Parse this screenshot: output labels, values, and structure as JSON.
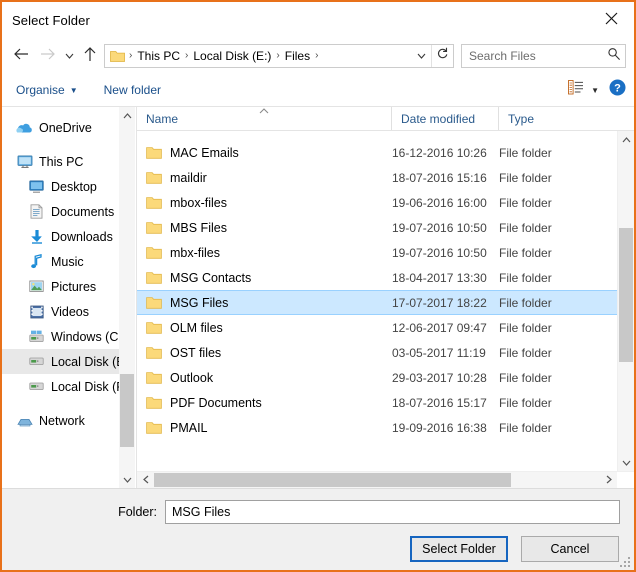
{
  "window": {
    "title": "Select Folder",
    "close_icon": "close-icon",
    "accent_border": "#e8711a"
  },
  "nav": {
    "back_icon": "arrow-left-icon",
    "forward_icon": "arrow-right-icon",
    "recent_icon": "chevron-down-icon",
    "up_icon": "arrow-up-icon",
    "address": {
      "folder_icon": "folder-icon",
      "crumbs": [
        "This PC",
        "Local Disk (E:)",
        "Files"
      ],
      "separator": "›",
      "dropdown_icon": "chevron-down-icon",
      "refresh_icon": "refresh-icon"
    },
    "search": {
      "placeholder": "Search Files",
      "value": "",
      "icon": "search-icon"
    }
  },
  "command_bar": {
    "organise_label": "Organise",
    "organise_caret": "▼",
    "new_folder_label": "New folder",
    "view_icon": "view-list-icon",
    "view_caret": "▼",
    "help_icon": "help-icon"
  },
  "sidebar": {
    "items": [
      {
        "label": "OneDrive",
        "icon": "onedrive-cloud-icon",
        "indent": false,
        "selected": false
      },
      {
        "label": "This PC",
        "icon": "this-pc-monitor-icon",
        "indent": false,
        "selected": false
      },
      {
        "label": "Desktop",
        "icon": "desktop-icon",
        "indent": true,
        "selected": false
      },
      {
        "label": "Documents",
        "icon": "documents-icon",
        "indent": true,
        "selected": false
      },
      {
        "label": "Downloads",
        "icon": "downloads-arrow-icon",
        "indent": true,
        "selected": false
      },
      {
        "label": "Music",
        "icon": "music-note-icon",
        "indent": true,
        "selected": false
      },
      {
        "label": "Pictures",
        "icon": "pictures-icon",
        "indent": true,
        "selected": false
      },
      {
        "label": "Videos",
        "icon": "videos-icon",
        "indent": true,
        "selected": false
      },
      {
        "label": "Windows (C:)",
        "icon": "windows-drive-icon",
        "indent": true,
        "selected": false
      },
      {
        "label": "Local Disk (E:)",
        "icon": "drive-icon",
        "indent": true,
        "selected": true
      },
      {
        "label": "Local Disk (F:)",
        "icon": "drive-icon",
        "indent": true,
        "selected": false
      },
      {
        "label": "Network",
        "icon": "network-icon",
        "indent": false,
        "selected": false
      }
    ],
    "scrollbar": {
      "up_icon": "chevron-up-icon",
      "down_icon": "chevron-down-icon",
      "thumb_top_pct": 72,
      "thumb_height_pct": 21
    }
  },
  "file_list": {
    "columns": [
      {
        "key": "name",
        "label": "Name",
        "sorted": "asc",
        "sort_icon": "caret-up-icon"
      },
      {
        "key": "date",
        "label": "Date modified",
        "sorted": "none"
      },
      {
        "key": "type",
        "label": "Type",
        "sorted": "none"
      }
    ],
    "rows": [
      {
        "name": "MAC Emails",
        "date": "16-12-2016 10:26",
        "type": "File folder",
        "icon": "folder-icon",
        "selected": false
      },
      {
        "name": "maildir",
        "date": "18-07-2016 15:16",
        "type": "File folder",
        "icon": "folder-icon",
        "selected": false
      },
      {
        "name": "mbox-files",
        "date": "19-06-2016 16:00",
        "type": "File folder",
        "icon": "folder-icon",
        "selected": false
      },
      {
        "name": "MBS Files",
        "date": "19-07-2016 10:50",
        "type": "File folder",
        "icon": "folder-icon",
        "selected": false
      },
      {
        "name": "mbx-files",
        "date": "19-07-2016 10:50",
        "type": "File folder",
        "icon": "folder-icon",
        "selected": false
      },
      {
        "name": "MSG Contacts",
        "date": "18-04-2017 13:30",
        "type": "File folder",
        "icon": "folder-icon",
        "selected": false
      },
      {
        "name": "MSG Files",
        "date": "17-07-2017 18:22",
        "type": "File folder",
        "icon": "folder-icon",
        "selected": true
      },
      {
        "name": "OLM files",
        "date": "12-06-2017 09:47",
        "type": "File folder",
        "icon": "folder-icon",
        "selected": false
      },
      {
        "name": "OST files",
        "date": "03-05-2017 11:19",
        "type": "File folder",
        "icon": "folder-icon",
        "selected": false
      },
      {
        "name": "Outlook",
        "date": "29-03-2017 10:28",
        "type": "File folder",
        "icon": "folder-icon",
        "selected": false
      },
      {
        "name": "PDF Documents",
        "date": "18-07-2016 15:17",
        "type": "File folder",
        "icon": "folder-icon",
        "selected": false
      },
      {
        "name": "PMAIL",
        "date": "19-09-2016 16:38",
        "type": "File folder",
        "icon": "folder-icon",
        "selected": false
      }
    ],
    "v_scrollbar": {
      "up_icon": "chevron-up-icon",
      "down_icon": "chevron-down-icon",
      "thumb_top_pct": 26,
      "thumb_height_pct": 44
    },
    "h_scrollbar": {
      "left_icon": "chevron-left-icon",
      "right_icon": "chevron-right-icon",
      "thumb_left_pct": 0,
      "thumb_width_pct": 80
    },
    "selection_color": "#cce8ff"
  },
  "footer": {
    "folder_label": "Folder:",
    "folder_value": "MSG Files",
    "select_button": "Select Folder",
    "cancel_button": "Cancel",
    "resize_grip_icon": "resize-grip-icon"
  }
}
